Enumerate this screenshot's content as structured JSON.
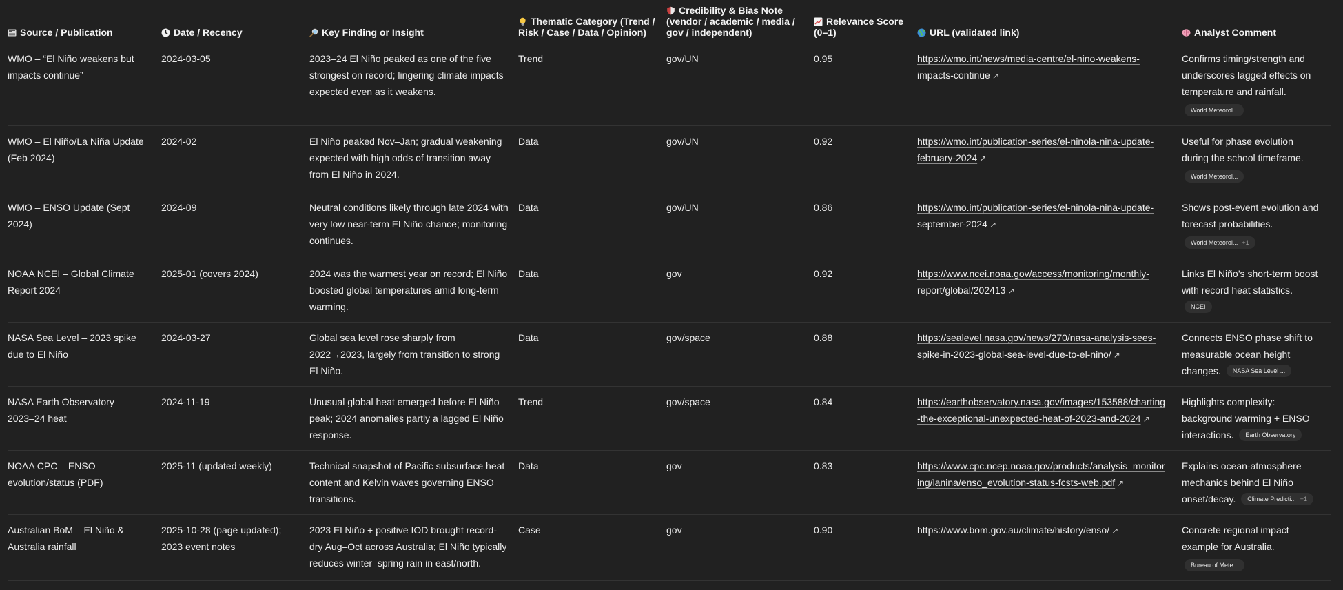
{
  "headers": [
    {
      "icon": "newspaper-icon",
      "label": "Source / Publication"
    },
    {
      "icon": "clock-icon",
      "label": "Date / Recency"
    },
    {
      "icon": "magnifier-icon",
      "label": "Key Finding or Insight"
    },
    {
      "icon": "lightbulb-icon",
      "label": "Thematic Category (Trend / Risk / Case / Data / Opinion)"
    },
    {
      "icon": "shield-icon",
      "label": "Credibility & Bias Note (vendor / academic / media / gov / independent)"
    },
    {
      "icon": "chart-up-icon",
      "label": "Relevance Score (0–1)"
    },
    {
      "icon": "globe-icon",
      "label": "URL (validated link)"
    },
    {
      "icon": "brain-icon",
      "label": "Analyst Comment"
    }
  ],
  "rows": [
    {
      "source": "WMO – “El Niño weakens but impacts continue”",
      "date": "2024-03-05",
      "finding": "2023–24 El Niño peaked as one of the five strongest on record; lingering climate impacts expected even as it weakens.",
      "category": "Trend",
      "credibility": "gov/UN",
      "score": "0.95",
      "url": "https://wmo.int/news/media-centre/el-nino-weakens-impacts-continue",
      "comment": "Confirms timing/strength and underscores lagged effects on temperature and rainfall.",
      "pill": "World Meteorol...",
      "pill_more": ""
    },
    {
      "source": "WMO – El Niño/La Niña Update (Feb 2024)",
      "date": "2024-02",
      "finding": "El Niño peaked Nov–Jan; gradual weakening expected with high odds of transition away from El Niño in 2024.",
      "category": "Data",
      "credibility": "gov/UN",
      "score": "0.92",
      "url": "https://wmo.int/publication-series/el-ninola-nina-update-february-2024",
      "comment": "Useful for phase evolution during the school timeframe.",
      "pill": "World Meteorol...",
      "pill_more": ""
    },
    {
      "source": "WMO – ENSO Update (Sept 2024)",
      "date": "2024-09",
      "finding": "Neutral conditions likely through late 2024 with very low near-term El Niño chance; monitoring continues.",
      "category": "Data",
      "credibility": "gov/UN",
      "score": "0.86",
      "url": "https://wmo.int/publication-series/el-ninola-nina-update-september-2024",
      "comment": "Shows post-event evolution and forecast probabilities.",
      "pill": "World Meteorol...",
      "pill_more": "+1"
    },
    {
      "source": "NOAA NCEI – Global Climate Report 2024",
      "date": "2025-01 (covers 2024)",
      "finding": "2024 was the warmest year on record; El Niño boosted global temperatures amid long-term warming.",
      "category": "Data",
      "credibility": "gov",
      "score": "0.92",
      "url": "https://www.ncei.noaa.gov/access/monitoring/monthly-report/global/202413",
      "comment": "Links El Niño’s short-term boost with record heat statistics.",
      "pill": "NCEI",
      "pill_more": ""
    },
    {
      "source": "NASA Sea Level – 2023 spike due to El Niño",
      "date": "2024-03-27",
      "finding": "Global sea level rose sharply from 2022→2023, largely from transition to strong El Niño.",
      "category": "Data",
      "credibility": "gov/space",
      "score": "0.88",
      "url": "https://sealevel.nasa.gov/news/270/nasa-analysis-sees-spike-in-2023-global-sea-level-due-to-el-nino/",
      "comment": "Connects ENSO phase shift to measurable ocean height changes.",
      "pill": "NASA Sea Level ...",
      "pill_more": ""
    },
    {
      "source": "NASA Earth Observatory – 2023–24 heat",
      "date": "2024-11-19",
      "finding": "Unusual global heat emerged before El Niño peak; 2024 anomalies partly a lagged El Niño response.",
      "category": "Trend",
      "credibility": "gov/space",
      "score": "0.84",
      "url": "https://earthobservatory.nasa.gov/images/153588/charting-the-exceptional-unexpected-heat-of-2023-and-2024",
      "comment": "Highlights complexity: background warming + ENSO interactions.",
      "pill": "Earth Observatory",
      "pill_more": ""
    },
    {
      "source": "NOAA CPC – ENSO evolution/status (PDF)",
      "date": "2025-11 (updated weekly)",
      "finding": "Technical snapshot of Pacific subsurface heat content and Kelvin waves governing ENSO transitions.",
      "category": "Data",
      "credibility": "gov",
      "score": "0.83",
      "url": "https://www.cpc.ncep.noaa.gov/products/analysis_monitoring/lanina/enso_evolution-status-fcsts-web.pdf",
      "comment": "Explains ocean-atmosphere mechanics behind El Niño onset/decay.",
      "pill": "Climate Predicti...",
      "pill_more": "+1"
    },
    {
      "source": "Australian BoM – El Niño & Australia rainfall",
      "date": "2025-10-28 (page updated); 2023 event notes",
      "finding": "2023 El Niño + positive IOD brought record-dry Aug–Oct across Australia; El Niño typically reduces winter–spring rain in east/north.",
      "category": "Case",
      "credibility": "gov",
      "score": "0.90",
      "url": "https://www.bom.gov.au/climate/history/enso/",
      "comment": "Concrete regional impact example for Australia.",
      "pill": "Bureau of Mete...",
      "pill_more": ""
    }
  ]
}
